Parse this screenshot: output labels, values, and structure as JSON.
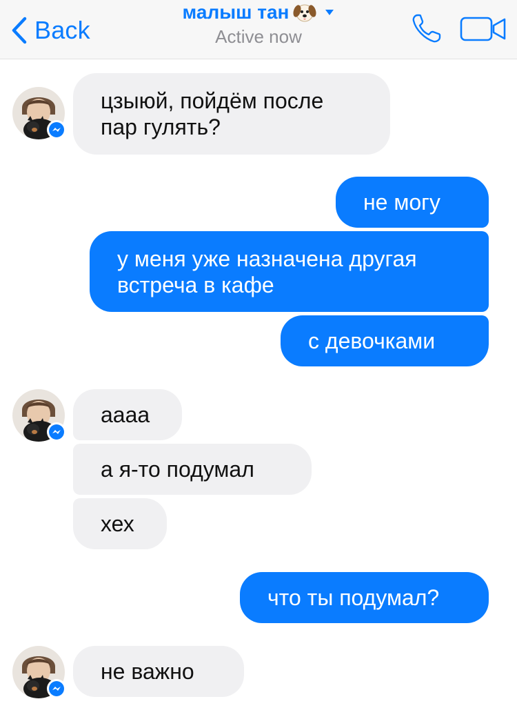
{
  "header": {
    "back_label": "Back",
    "contact_name": "малыш тан",
    "status": "Active now",
    "title_emoji": "dog-face-emoji",
    "accent_color": "#0a7cff"
  },
  "conversation": {
    "incoming_color": "#f0f0f2",
    "outgoing_color": "#0a7cff",
    "messages": [
      {
        "sender": "contact",
        "lines": [
          "цзыюй, пойдём после",
          "пар гулять?"
        ]
      },
      {
        "sender": "me",
        "lines": [
          "не могу"
        ]
      },
      {
        "sender": "me",
        "lines": [
          "у меня уже назначена другая",
          "встреча в кафе"
        ]
      },
      {
        "sender": "me",
        "lines": [
          "с девочками"
        ]
      },
      {
        "sender": "contact",
        "lines": [
          "аааа"
        ]
      },
      {
        "sender": "contact",
        "lines": [
          "а я-то подумал"
        ]
      },
      {
        "sender": "contact",
        "lines": [
          "хех"
        ]
      },
      {
        "sender": "me",
        "lines": [
          "что ты подумал?"
        ]
      },
      {
        "sender": "contact",
        "lines": [
          "не важно"
        ]
      }
    ]
  }
}
